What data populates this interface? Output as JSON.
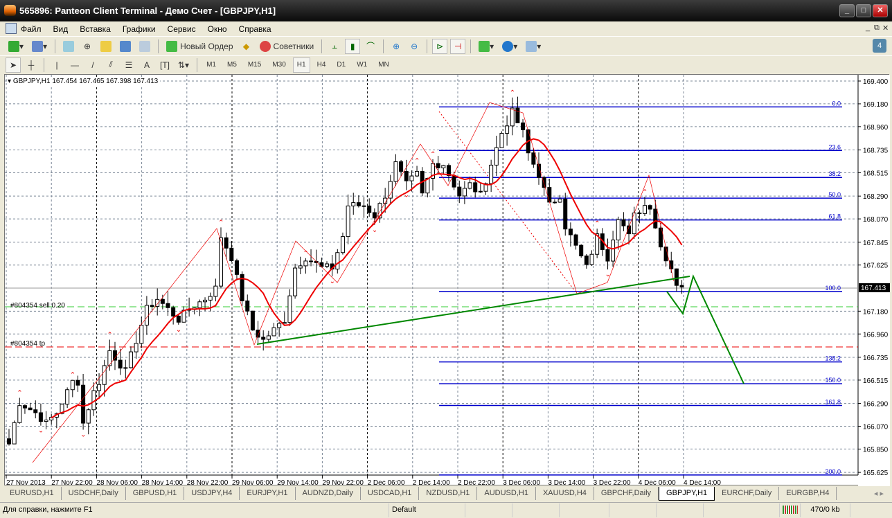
{
  "window": {
    "title": "565896: Panteon Client Terminal - Демо Счет - [GBPJPY,H1]"
  },
  "menu": [
    "Файл",
    "Вид",
    "Вставка",
    "Графики",
    "Сервис",
    "Окно",
    "Справка"
  ],
  "toolbar": {
    "new_order": "Новый Ордер",
    "experts": "Советники"
  },
  "timeframes": [
    "M1",
    "M5",
    "M15",
    "M30",
    "H1",
    "H4",
    "D1",
    "W1",
    "MN"
  ],
  "active_timeframe": "H1",
  "chart": {
    "header": "GBPJPY,H1  167.454 167.465 167.398 167.413",
    "current_price": "167.413",
    "order_labels": [
      "#804354 sell 0.20",
      "#804354 tp"
    ],
    "price_ticks": [
      "169.400",
      "169.180",
      "168.960",
      "168.735",
      "168.515",
      "168.290",
      "168.070",
      "167.845",
      "167.625",
      "167.180",
      "166.960",
      "166.735",
      "166.515",
      "166.290",
      "166.070",
      "165.850",
      "165.625"
    ],
    "time_ticks": [
      "27 Nov 2013",
      "27 Nov 22:00",
      "28 Nov 06:00",
      "28 Nov 14:00",
      "28 Nov 22:00",
      "29 Nov 06:00",
      "29 Nov 14:00",
      "29 Nov 22:00",
      "2 Dec 06:00",
      "2 Dec 14:00",
      "2 Dec 22:00",
      "3 Dec 06:00",
      "3 Dec 14:00",
      "3 Dec 22:00",
      "4 Dec 06:00",
      "4 Dec 14:00"
    ],
    "fib_levels": [
      {
        "label": "0.0",
        "price": 169.15
      },
      {
        "label": "23.6",
        "price": 168.73
      },
      {
        "label": "38.2",
        "price": 168.47
      },
      {
        "label": "50.0",
        "price": 168.27
      },
      {
        "label": "61.8",
        "price": 168.06
      },
      {
        "label": "100.0",
        "price": 167.37
      },
      {
        "label": "138.2",
        "price": 166.69
      },
      {
        "label": "150.0",
        "price": 166.48
      },
      {
        "label": "161.8",
        "price": 166.27
      },
      {
        "label": "200.0",
        "price": 165.6
      }
    ],
    "close_waypoints": [
      [
        0,
        165.9
      ],
      [
        2,
        166.3
      ],
      [
        5,
        166.2
      ],
      [
        7,
        166.1
      ],
      [
        9,
        166.2
      ],
      [
        11,
        166.4
      ],
      [
        13,
        166.5
      ],
      [
        12,
        166.5
      ],
      [
        14,
        166.1
      ],
      [
        16,
        166.4
      ],
      [
        17,
        166.5
      ],
      [
        19,
        166.8
      ],
      [
        22,
        166.6
      ],
      [
        24,
        166.9
      ],
      [
        26,
        167.2
      ],
      [
        28,
        167.3
      ],
      [
        32,
        167.1
      ],
      [
        34,
        167.2
      ],
      [
        37,
        167.3
      ],
      [
        39,
        167.4
      ],
      [
        40,
        167.9
      ],
      [
        42,
        167.7
      ],
      [
        44,
        167.3
      ],
      [
        46,
        167.0
      ],
      [
        48,
        166.9
      ],
      [
        50,
        167.0
      ],
      [
        52,
        167.1
      ],
      [
        54,
        167.6
      ],
      [
        56,
        167.7
      ],
      [
        59,
        167.6
      ],
      [
        61,
        167.6
      ],
      [
        63,
        167.9
      ],
      [
        64,
        168.2
      ],
      [
        67,
        168.2
      ],
      [
        69,
        168.1
      ],
      [
        71,
        168.3
      ],
      [
        73,
        168.6
      ],
      [
        75,
        168.4
      ],
      [
        77,
        168.5
      ],
      [
        78,
        168.3
      ],
      [
        80,
        168.6
      ],
      [
        82,
        168.6
      ],
      [
        85,
        168.3
      ],
      [
        87,
        168.4
      ],
      [
        89,
        168.3
      ],
      [
        91,
        168.6
      ],
      [
        93,
        168.9
      ],
      [
        95,
        169.1
      ],
      [
        97,
        168.9
      ],
      [
        98,
        168.7
      ],
      [
        100,
        168.5
      ],
      [
        102,
        168.2
      ],
      [
        104,
        168.3
      ],
      [
        105,
        168.0
      ],
      [
        107,
        167.8
      ],
      [
        109,
        167.6
      ],
      [
        111,
        167.9
      ],
      [
        113,
        167.7
      ],
      [
        115,
        168.1
      ],
      [
        117,
        167.9
      ],
      [
        118,
        168.1
      ],
      [
        120,
        168.2
      ],
      [
        121,
        168.2
      ],
      [
        123,
        167.8
      ],
      [
        125,
        167.6
      ],
      [
        126,
        167.45
      ],
      [
        127,
        167.41
      ]
    ]
  },
  "tabs": [
    "EURUSD,H1",
    "USDCHF,Daily",
    "GBPUSD,H1",
    "USDJPY,H4",
    "EURJPY,H1",
    "AUDNZD,Daily",
    "USDCAD,H1",
    "NZDUSD,H1",
    "AUDUSD,H1",
    "XAUUSD,H4",
    "GBPCHF,Daily",
    "GBPJPY,H1",
    "EURCHF,Daily",
    "EURGBP,H4"
  ],
  "active_tab": "GBPJPY,H1",
  "status": {
    "help": "Для справки, нажмите F1",
    "profile": "Default",
    "traffic": "470/0 kb"
  },
  "colors": {
    "fib": "#0000cc",
    "ma": "#e00000",
    "trend": "#008000"
  }
}
